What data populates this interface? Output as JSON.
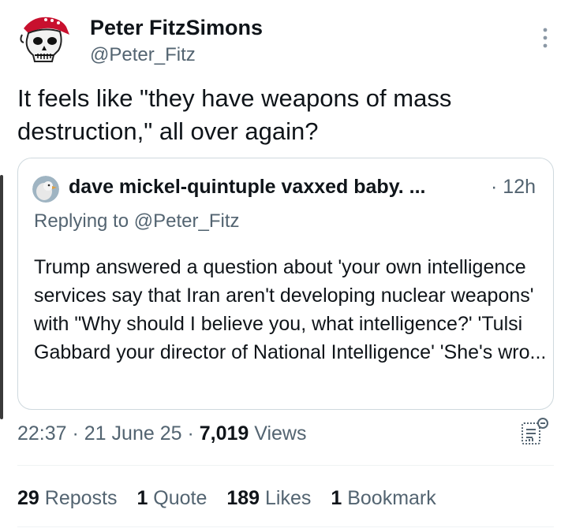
{
  "author": {
    "name": "Peter FitzSimons",
    "handle": "@Peter_Fitz"
  },
  "tweet": {
    "text": "It feels like \"they have weapons of mass\ndestruction,\" all over again?"
  },
  "quoted": {
    "name": "dave mickel-quintuple vaxxed baby. ...",
    "time": "· 12h",
    "replying_prefix": "Replying to ",
    "replying_handle": "@Peter_Fitz",
    "text": "Trump answered a question about 'your own intelligence services say that Iran aren't developing nuclear weapons' with \"Why should I believe you, what intelligence?' 'Tulsi Gabbard your director of National Intelligence' 'She's wro..."
  },
  "meta": {
    "time": "22:37",
    "date": "21 June 25",
    "views_count": "7,019",
    "views_label": "Views"
  },
  "stats": {
    "reposts": {
      "count": "29",
      "label": "Reposts"
    },
    "quotes": {
      "count": "1",
      "label": "Quote"
    },
    "likes": {
      "count": "189",
      "label": "Likes"
    },
    "bookmarks": {
      "count": "1",
      "label": "Bookmark"
    }
  },
  "icons": {
    "more": "more-vertical-icon",
    "analytics": "analytics-icon"
  },
  "colors": {
    "primary_text": "#0f1419",
    "secondary_text": "#536471",
    "border": "#cfd9de",
    "avatar_bandana": "#c8102e"
  }
}
